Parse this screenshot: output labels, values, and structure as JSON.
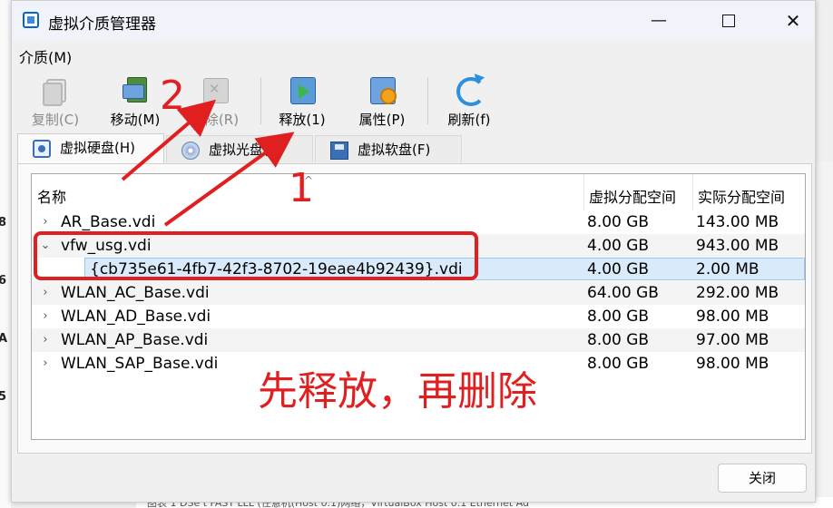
{
  "window": {
    "title": "虚拟介质管理器",
    "minimize_glyph": "—",
    "close_glyph": "✕"
  },
  "menu": {
    "media": "介质(M)"
  },
  "toolbar": {
    "copy": "复制(C)",
    "move": "移动(M)",
    "delete": "删除(R)",
    "release": "释放(1)",
    "properties": "属性(P)",
    "refresh": "刷新(f)"
  },
  "tabs": [
    {
      "label": "虚拟硬盘(H)",
      "icon": "hard-disk-icon"
    },
    {
      "label": "虚拟光盘(D)",
      "icon": "optical-disk-icon"
    },
    {
      "label": "虚拟软盘(F)",
      "icon": "floppy-disk-icon"
    }
  ],
  "columns": {
    "name": "名称",
    "virtual_size": "虚拟分配空间",
    "actual_size": "实际分配空间"
  },
  "rows": [
    {
      "name": "AR_Base.vdi",
      "virtual": "8.00 GB",
      "actual": "143.00 MB",
      "expander": "›"
    },
    {
      "name": "vfw_usg.vdi",
      "virtual": "4.00 GB",
      "actual": "943.00 MB",
      "expander": "⌄"
    },
    {
      "name": "{cb735e61-4fb7-42f3-8702-19eae4b92439}.vdi",
      "virtual": "4.00 GB",
      "actual": "2.00 MB"
    },
    {
      "name": "WLAN_AC_Base.vdi",
      "virtual": "64.00 GB",
      "actual": "292.00 MB",
      "expander": "›"
    },
    {
      "name": "WLAN_AD_Base.vdi",
      "virtual": "8.00 GB",
      "actual": "98.00 MB",
      "expander": "›"
    },
    {
      "name": "WLAN_AP_Base.vdi",
      "virtual": "8.00 GB",
      "actual": "97.00 MB",
      "expander": "›"
    },
    {
      "name": "WLAN_SAP_Base.vdi",
      "virtual": "8.00 GB",
      "actual": "98.00 MB",
      "expander": "›"
    }
  ],
  "footer": {
    "close": "关闭"
  },
  "annotations": {
    "step1": "1",
    "step2": "2",
    "message": "先释放，再删除",
    "color": "#e02020"
  },
  "background": {
    "left_chars": [
      "8",
      "6",
      "A",
      "5"
    ],
    "bottom_text": "图表 1 DSe t FAST LLL (任意机(Host 0.1)网络，VirtualBox Host 0.1 Ethernet Ad"
  }
}
